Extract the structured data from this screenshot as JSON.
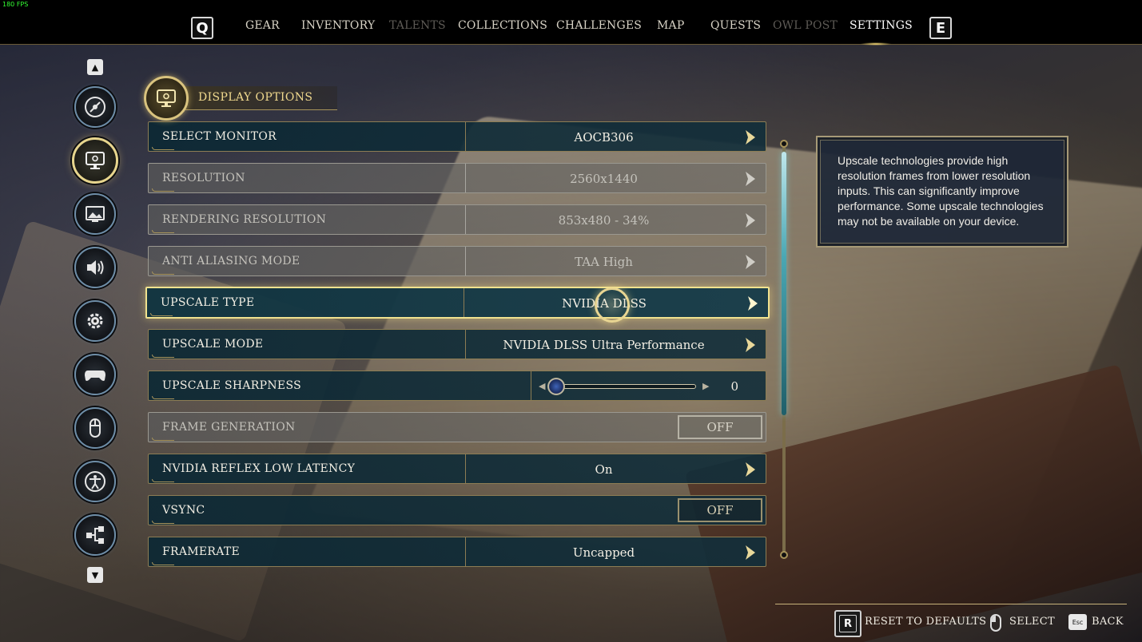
{
  "fps_counter": "180 FPS",
  "nav": {
    "left_key": "Q",
    "right_key": "E",
    "tabs": [
      {
        "label": "GEAR",
        "state": "normal"
      },
      {
        "label": "INVENTORY",
        "state": "normal"
      },
      {
        "label": "TALENTS",
        "state": "disabled"
      },
      {
        "label": "COLLECTIONS",
        "state": "normal"
      },
      {
        "label": "CHALLENGES",
        "state": "normal"
      },
      {
        "label": "MAP",
        "state": "normal"
      },
      {
        "label": "QUESTS",
        "state": "normal"
      },
      {
        "label": "OWL POST",
        "state": "disabled"
      },
      {
        "label": "SETTINGS",
        "state": "active"
      }
    ]
  },
  "sidebar": {
    "items": [
      {
        "icon": "disc-icon",
        "active": false
      },
      {
        "icon": "monitor-settings-icon",
        "active": true
      },
      {
        "icon": "picture-icon",
        "active": false
      },
      {
        "icon": "speaker-icon",
        "active": false
      },
      {
        "icon": "gear-icon",
        "active": false
      },
      {
        "icon": "gamepad-icon",
        "active": false
      },
      {
        "icon": "mouse-icon",
        "active": false
      },
      {
        "icon": "accessibility-icon",
        "active": false
      },
      {
        "icon": "network-icon",
        "active": false
      }
    ]
  },
  "section": {
    "title": "DISPLAY OPTIONS",
    "icon": "monitor-settings-icon"
  },
  "settings": [
    {
      "label": "SELECT MONITOR",
      "value": "AOCB306",
      "control": "selector",
      "disabled": false
    },
    {
      "label": "RESOLUTION",
      "value": "2560x1440",
      "control": "selector",
      "disabled": true
    },
    {
      "label": "RENDERING RESOLUTION",
      "value": "853x480 - 34%",
      "control": "selector",
      "disabled": true
    },
    {
      "label": "ANTI ALIASING MODE",
      "value": "TAA High",
      "control": "selector",
      "disabled": true
    },
    {
      "label": "UPSCALE TYPE",
      "value": "NVIDIA DLSS",
      "control": "selector",
      "disabled": false,
      "selected": true
    },
    {
      "label": "UPSCALE MODE",
      "value": "NVIDIA DLSS Ultra Performance",
      "control": "selector",
      "disabled": false
    },
    {
      "label": "UPSCALE SHARPNESS",
      "value": "0",
      "control": "slider",
      "disabled": false,
      "slider_fraction": 0
    },
    {
      "label": "FRAME GENERATION",
      "value": "OFF",
      "control": "toggle",
      "disabled": true
    },
    {
      "label": "NVIDIA REFLEX LOW LATENCY",
      "value": "On",
      "control": "selector",
      "disabled": false
    },
    {
      "label": "VSYNC",
      "value": "OFF",
      "control": "toggle",
      "disabled": false
    },
    {
      "label": "FRAMERATE",
      "value": "Uncapped",
      "control": "selector",
      "disabled": false
    }
  ],
  "description": {
    "text": "Upscale technologies provide high resolution frames from lower resolution inputs. This can significantly improve performance. Some upscale technologies may not be available on your device."
  },
  "footer": {
    "reset_key": "R",
    "reset_label": "RESET TO DEFAULTS",
    "select_label": "SELECT",
    "back_key": "Esc",
    "back_label": "BACK"
  },
  "colors": {
    "accent_gold": "#e7d58d",
    "row_teal": "#0c2834",
    "scroll_cyan": "#4aa7b3"
  }
}
